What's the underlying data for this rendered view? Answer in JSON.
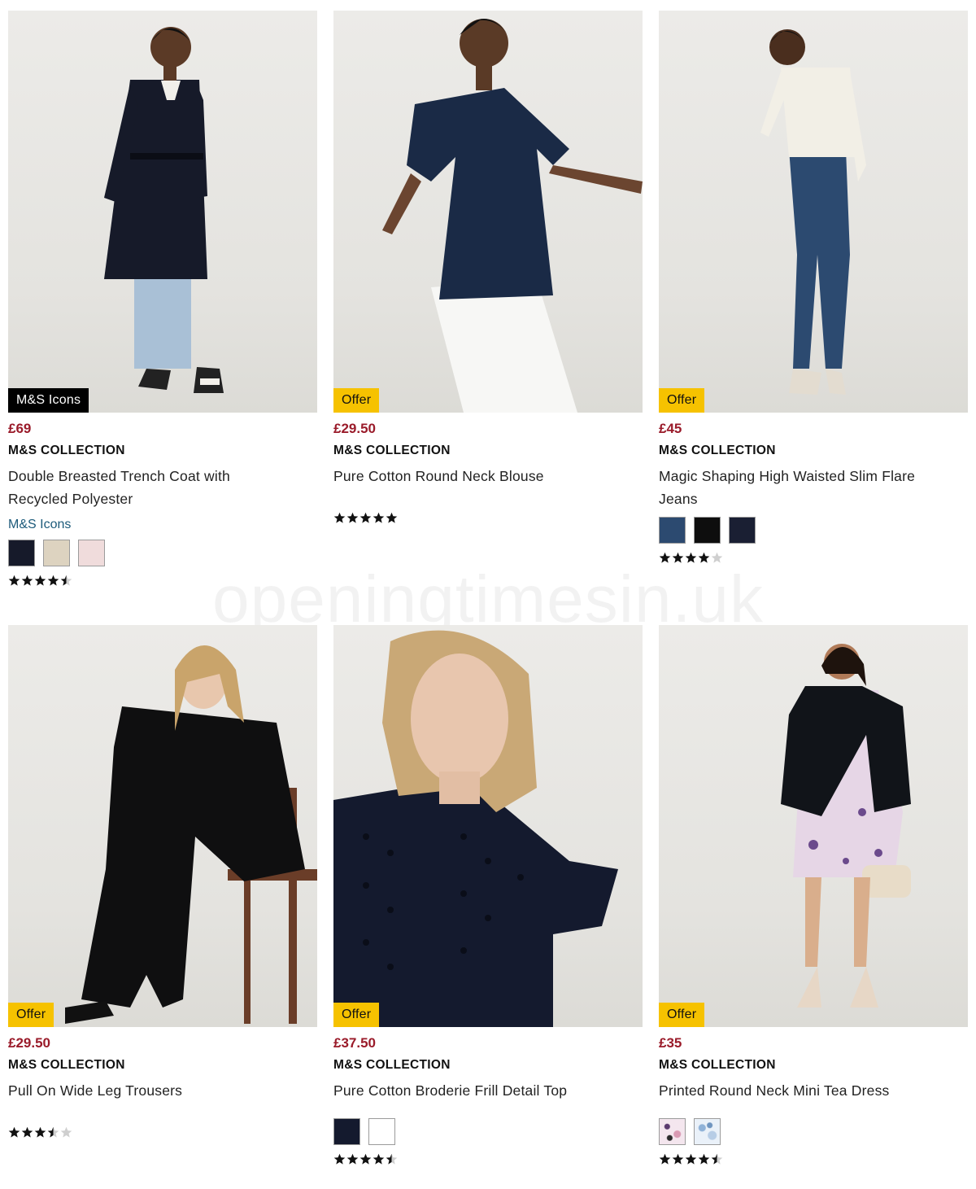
{
  "colors": {
    "price_red": "#9a1b2a",
    "offer_yellow": "#f6c200",
    "icons_black": "#000000",
    "subline_blue": "#1c5a7a",
    "star_filled": "#111111",
    "star_empty": "#cfcfcf"
  },
  "products": [
    {
      "badge": "M&S Icons",
      "badge_type": "icons",
      "price": "£69",
      "brand": "M&S COLLECTION",
      "title_line1": "Double Breasted Trench Coat with",
      "title_line2": "Recycled Polyester",
      "subline": "M&S Icons",
      "swatches": [
        "#161a2a",
        "#ddd3c0",
        "#f0dcdc"
      ],
      "rating": 4.5,
      "photo_desc": "trench-coat-model"
    },
    {
      "badge": "Offer",
      "badge_type": "offer",
      "price": "£29.50",
      "brand": "M&S COLLECTION",
      "title_line1": "Pure Cotton Round Neck Blouse",
      "title_line2": "",
      "subline": "",
      "swatches": [],
      "rating": 5,
      "photo_desc": "navy-blouse-model"
    },
    {
      "badge": "Offer",
      "badge_type": "offer",
      "price": "£45",
      "brand": "M&S COLLECTION",
      "title_line1": "Magic Shaping High Waisted Slim Flare",
      "title_line2": "Jeans",
      "subline": "",
      "swatches": [
        "#2c4a70",
        "#0e0e0e",
        "#1a1f33"
      ],
      "rating": 4,
      "photo_desc": "flare-jeans-model"
    },
    {
      "badge": "Offer",
      "badge_type": "offer",
      "price": "£29.50",
      "brand": "M&S COLLECTION",
      "title_line1": "Pull On Wide Leg Trousers",
      "title_line2": "",
      "subline": "",
      "swatches": [],
      "rating": 3.5,
      "photo_desc": "wide-leg-trousers-model"
    },
    {
      "badge": "Offer",
      "badge_type": "offer",
      "price": "£37.50",
      "brand": "M&S COLLECTION",
      "title_line1": "Pure Cotton Broderie Frill Detail Top",
      "title_line2": "",
      "subline": "",
      "swatches": [
        "#141a2e",
        "#ffffff"
      ],
      "rating": 4.5,
      "photo_desc": "broderie-top-model"
    },
    {
      "badge": "Offer",
      "badge_type": "offer",
      "price": "£35",
      "brand": "M&S COLLECTION",
      "title_line1": "Printed Round Neck Mini Tea Dress",
      "title_line2": "",
      "subline": "",
      "swatches": [
        "floral-pink",
        "floral-blue"
      ],
      "rating": 4.5,
      "photo_desc": "mini-tea-dress-model"
    }
  ],
  "watermark": "openingtimesin.uk"
}
